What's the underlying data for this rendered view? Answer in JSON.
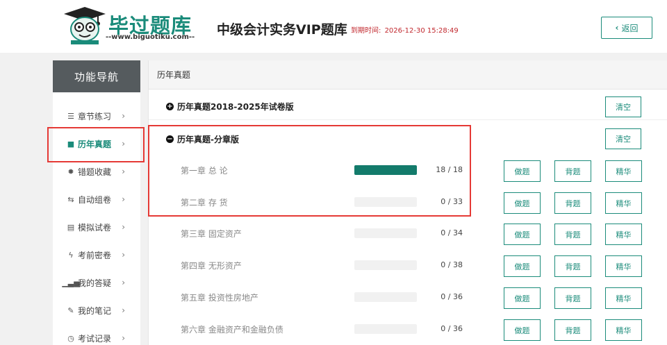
{
  "header": {
    "logo_name": "毕过题库",
    "logo_url": "--www.biguotiku.com--",
    "app_title": "中级会计实务VIP题库",
    "expire_label": "到期时间:",
    "expire_value": "2026-12-30 15:28:49",
    "back_label": "返回"
  },
  "sidebar": {
    "title": "功能导航",
    "items": [
      {
        "label": "章节练习",
        "icon": "list-icon"
      },
      {
        "label": "历年真题",
        "icon": "book-icon",
        "active": true
      },
      {
        "label": "错题收藏",
        "icon": "gear-icon"
      },
      {
        "label": "自动组卷",
        "icon": "loop-icon"
      },
      {
        "label": "模拟试卷",
        "icon": "document-icon"
      },
      {
        "label": "考前密卷",
        "icon": "lightning-icon"
      },
      {
        "label": "我的答疑",
        "icon": "signal-icon"
      },
      {
        "label": "我的笔记",
        "icon": "pin-icon"
      },
      {
        "label": "考试记录",
        "icon": "clock-icon"
      }
    ]
  },
  "main": {
    "breadcrumb": "历年真题",
    "groups": [
      {
        "title": "历年真题2018-2025年试卷版",
        "state": "collapsed",
        "clear_label": "清空"
      },
      {
        "title": "历年真题-分章版",
        "state": "expanded",
        "clear_label": "清空"
      }
    ],
    "chapters": [
      {
        "name": "第一章 总 论",
        "count": "18 / 18",
        "progress": 1.0
      },
      {
        "name": "第二章 存 货",
        "count": "0 / 33",
        "progress": 0
      },
      {
        "name": "第三章 固定资产",
        "count": "0 / 34",
        "progress": 0
      },
      {
        "name": "第四章 无形资产",
        "count": "0 / 38",
        "progress": 0
      },
      {
        "name": "第五章 投资性房地产",
        "count": "0 / 36",
        "progress": 0
      },
      {
        "name": "第六章 金融资产和金融负债",
        "count": "0 / 36",
        "progress": 0
      }
    ],
    "actions": {
      "do": "做题",
      "recite": "背题",
      "essence": "精华"
    }
  },
  "colors": {
    "accent": "#1a8b7a",
    "progress": "#137b6b",
    "highlight": "#e53935",
    "expire": "#c1272d"
  }
}
